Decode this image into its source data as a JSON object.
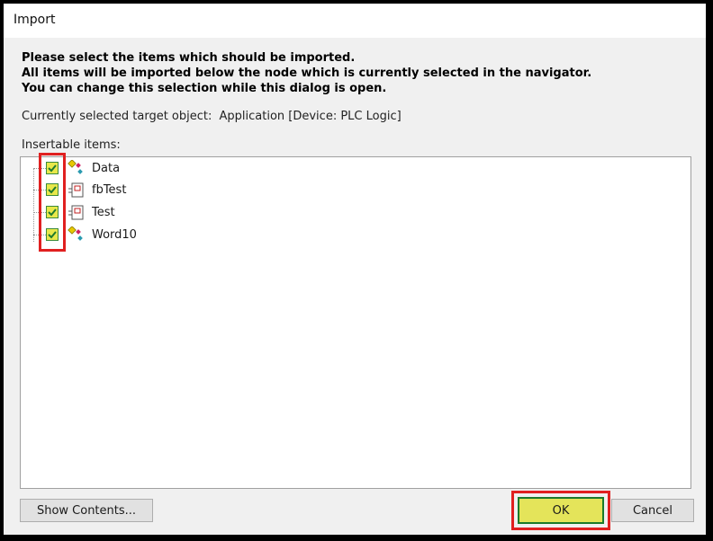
{
  "window": {
    "title": "Import"
  },
  "instructions": [
    "Please select the items which should be imported.",
    "All items will be imported below the node which is currently selected in the navigator.",
    "You can change this selection while this dialog is open."
  ],
  "target": {
    "label": "Currently selected target object:",
    "value": "Application [Device: PLC Logic]"
  },
  "insertable_label": "Insertable items:",
  "items": [
    {
      "label": "Data",
      "icon": "data-type-icon",
      "checked": true
    },
    {
      "label": "fbTest",
      "icon": "function-block-icon",
      "checked": true
    },
    {
      "label": "Test",
      "icon": "function-block-icon",
      "checked": true
    },
    {
      "label": "Word10",
      "icon": "data-type-icon",
      "checked": true
    }
  ],
  "buttons": {
    "show_contents": "Show Contents...",
    "ok": "OK",
    "cancel": "Cancel"
  },
  "colors": {
    "highlight_outline": "#e02020",
    "checkbox_fill": "#e8e84a",
    "ok_fill": "#e4e45a"
  }
}
